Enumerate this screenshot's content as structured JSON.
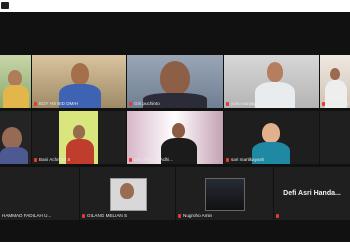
{
  "participants": [
    {
      "name": "EDY HS BID DMIH",
      "row": 0
    },
    {
      "name": "Giri puchinto",
      "row": 0
    },
    {
      "name": "yono sanjaya",
      "row": 0
    },
    {
      "name": "Haryo LiWi",
      "row": 0
    },
    {
      "name": "Bani Achmad S",
      "row": 1
    },
    {
      "name": "Leo. Ikhtiad. Adhi...",
      "row": 1
    },
    {
      "name": "sari martikayanti",
      "row": 1
    },
    {
      "name": "HAMMAD FADILAH U...",
      "row": 2
    },
    {
      "name": "GILANG MELIAN S",
      "row": 2
    },
    {
      "name": "Nugroho Amin",
      "row": 2
    },
    {
      "name": "Defi Asri Handa...",
      "row": 2
    }
  ],
  "colors": {
    "active_border": "#35d35a",
    "muted_mic": "#e53935",
    "stage_bg": "#111111"
  }
}
